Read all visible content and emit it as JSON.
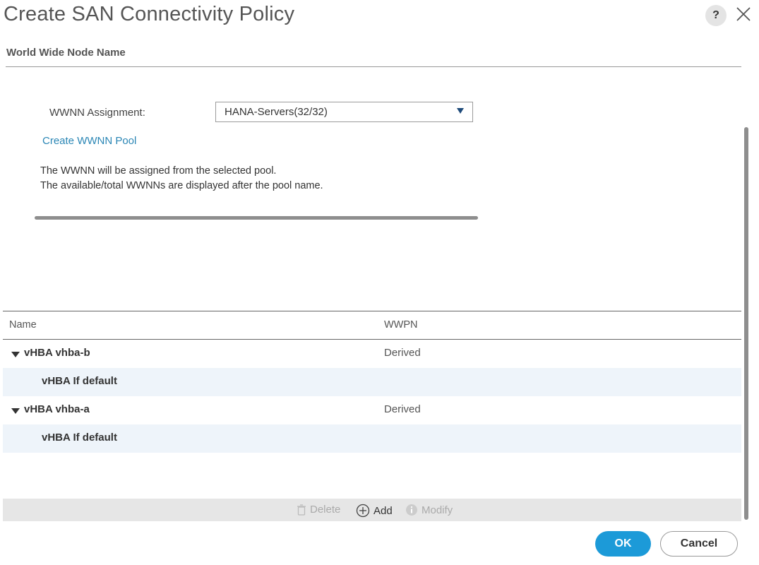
{
  "dialog": {
    "title": "Create SAN Connectivity Policy",
    "help_label": "?"
  },
  "section": {
    "title": "World Wide Node Name"
  },
  "wwnn": {
    "label": "WWNN Assignment:",
    "selected": "HANA-Servers(32/32)",
    "create_link": "Create WWNN Pool",
    "info_line1": "The WWNN will be assigned from the selected pool.",
    "info_line2": "The available/total WWNNs are displayed after the pool name."
  },
  "table": {
    "columns": [
      "Name",
      "WWPN"
    ],
    "rows": [
      {
        "name": "vHBA vhba-b",
        "wwpn": "Derived",
        "expandable": true
      },
      {
        "name": "vHBA If default",
        "wwpn": "",
        "expandable": false
      },
      {
        "name": "vHBA vhba-a",
        "wwpn": "Derived",
        "expandable": true
      },
      {
        "name": "vHBA If default",
        "wwpn": "",
        "expandable": false
      }
    ]
  },
  "toolbar": {
    "delete_label": "Delete",
    "add_label": "Add",
    "modify_label": "Modify"
  },
  "footer": {
    "ok_label": "OK",
    "cancel_label": "Cancel"
  },
  "colors": {
    "accent": "#1c9ad8",
    "link": "#2a86b5",
    "row_alt": "#eef4fa"
  },
  "icons": {
    "help": "question-icon",
    "close": "close-icon",
    "dropdown": "chevron-down-icon",
    "delete": "trash-icon",
    "add": "plus-circle-icon",
    "modify": "info-circle-icon"
  }
}
